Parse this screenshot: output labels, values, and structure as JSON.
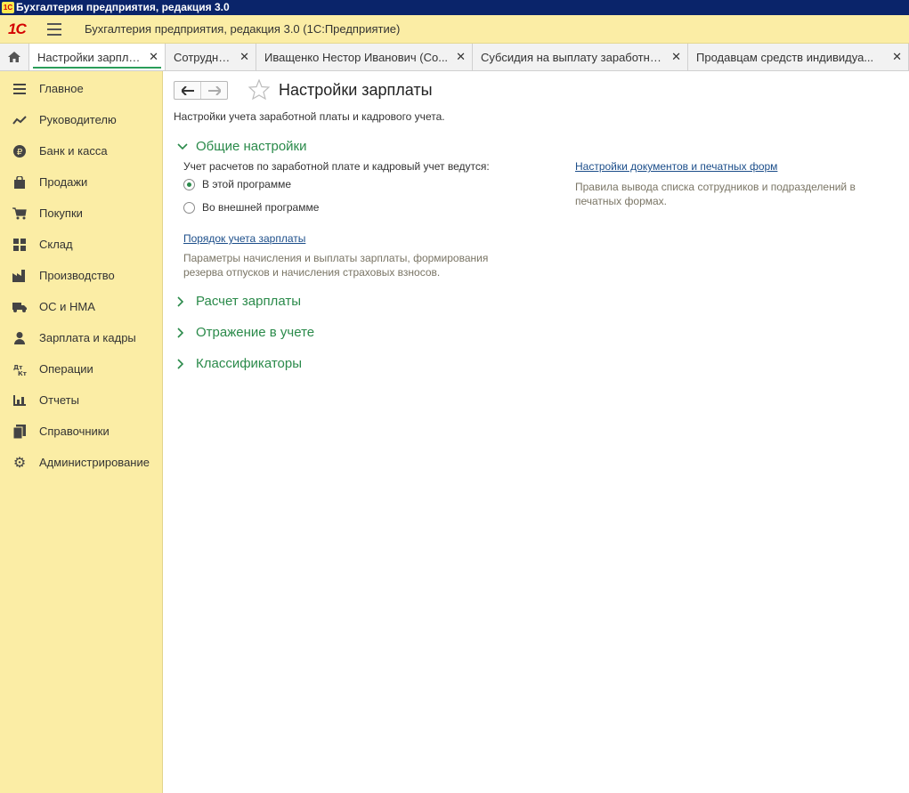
{
  "window": {
    "title": "Бухгалтерия предприятия, редакция 3.0"
  },
  "app": {
    "title": "Бухгалтерия предприятия, редакция 3.0  (1С:Предприятие)",
    "logo": "1С"
  },
  "tabs": [
    {
      "label": "Настройки зарплаты",
      "active": true
    },
    {
      "label": "Сотрудники",
      "active": false
    },
    {
      "label": "Иващенко Нестор Иванович (Со...",
      "active": false
    },
    {
      "label": "Субсидия на выплату заработно...",
      "active": false
    },
    {
      "label": "Продавцам средств индивидуа...",
      "active": false
    }
  ],
  "sidebar": {
    "items": [
      {
        "label": "Главное",
        "icon": "menu-lines-icon"
      },
      {
        "label": "Руководителю",
        "icon": "trend-icon"
      },
      {
        "label": "Банк и касса",
        "icon": "ruble-icon"
      },
      {
        "label": "Продажи",
        "icon": "bag-icon"
      },
      {
        "label": "Покупки",
        "icon": "cart-icon"
      },
      {
        "label": "Склад",
        "icon": "grid-icon"
      },
      {
        "label": "Производство",
        "icon": "factory-icon"
      },
      {
        "label": "ОС и НМА",
        "icon": "truck-icon"
      },
      {
        "label": "Зарплата и кадры",
        "icon": "person-icon"
      },
      {
        "label": "Операции",
        "icon": "dt-kt-icon"
      },
      {
        "label": "Отчеты",
        "icon": "bar-chart-icon"
      },
      {
        "label": "Справочники",
        "icon": "books-icon"
      },
      {
        "label": "Администрирование",
        "icon": "gear-icon"
      }
    ]
  },
  "page": {
    "title": "Настройки зарплаты",
    "description": "Настройки учета заработной платы и кадрового учета.",
    "general": {
      "heading": "Общие настройки",
      "question": "Учет расчетов по заработной плате и кадровый учет ведутся:",
      "option_internal": "В этой программе",
      "option_external": "Во внешней программе",
      "selected": "В этой программе",
      "link_order": "Порядок учета зарплаты",
      "link_order_hint": "Параметры начисления и выплаты зарплаты, формирования резерва отпусков и начисления страховых взносов.",
      "link_docs": "Настройки документов и печатных форм",
      "link_docs_hint": "Правила вывода списка сотрудников и подразделений в печатных формах."
    },
    "sections": [
      {
        "label": "Расчет зарплаты"
      },
      {
        "label": "Отражение в учете"
      },
      {
        "label": "Классификаторы"
      }
    ]
  },
  "colors": {
    "accent_green": "#2a8a4a",
    "sidebar_bg": "#fbeda5",
    "link": "#1c4e8a",
    "titlebar": "#0a246a"
  }
}
